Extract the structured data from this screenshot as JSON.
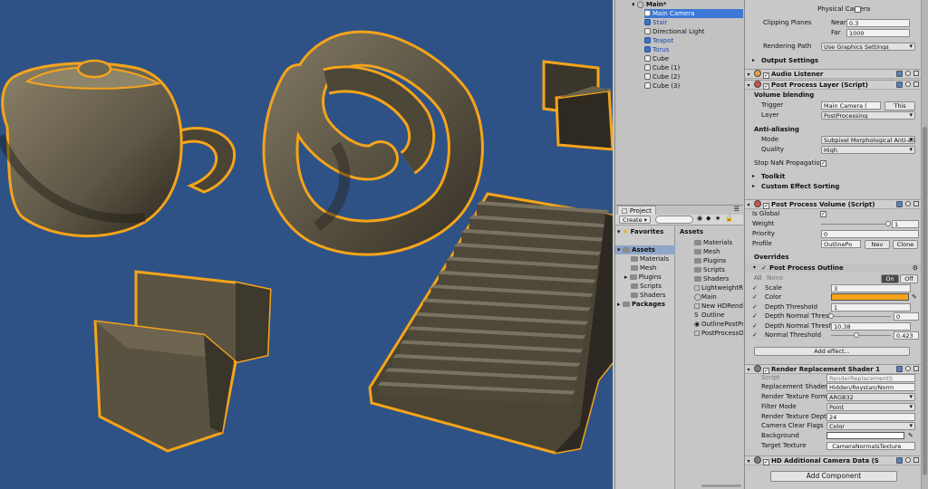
{
  "hierarchy": {
    "scene_name": "Main*",
    "items": [
      {
        "label": "Main Camera",
        "selected": true
      },
      {
        "label": "Stair",
        "prefab": true
      },
      {
        "label": "Directional Light"
      },
      {
        "label": "Teapot",
        "prefab": true
      },
      {
        "label": "Torus",
        "prefab": true
      },
      {
        "label": "Cube"
      },
      {
        "label": "Cube (1)"
      },
      {
        "label": "Cube (2)"
      },
      {
        "label": "Cube (3)"
      }
    ]
  },
  "project": {
    "tab_label": "Project",
    "create_label": "Create",
    "favorites_label": "Favorites",
    "assets_label": "Assets",
    "packages_label": "Packages",
    "tree": [
      "Materials",
      "Mesh",
      "Plugins",
      "Scripts",
      "Shaders"
    ],
    "assets_header": "Assets",
    "asset_items": [
      "Materials",
      "Mesh",
      "Plugins",
      "Scripts",
      "Shaders",
      "LightweightRend",
      "Main",
      "New HDRender",
      "Outline",
      "OutlinePostProf",
      "PostProcessOut"
    ]
  },
  "inspector": {
    "camera_tail": {
      "physical_camera_label": "Physical Camera",
      "clipping_planes_label": "Clipping Planes",
      "near_label": "Near",
      "near_value": "0.3",
      "far_label": "Far",
      "far_value": "1000",
      "rendering_path_label": "Rendering Path",
      "rendering_path_value": "Use Graphics Settings",
      "output_settings_label": "Output Settings"
    },
    "audio_listener_label": "Audio Listener",
    "post_process_layer": {
      "title": "Post Process Layer (Script)",
      "volume_blending_label": "Volume blending",
      "trigger_label": "Trigger",
      "trigger_value": "Main Camera (",
      "this_label": "This",
      "layer_label": "Layer",
      "layer_value": "PostProcessing",
      "anti_aliasing_label": "Anti-aliasing",
      "mode_label": "Mode",
      "mode_value": "Subpixel Morphological Anti-alia",
      "quality_label": "Quality",
      "quality_value": "High",
      "stop_nan_label": "Stop NaN Propagatio",
      "toolkit_label": "Toolkit",
      "custom_sorting_label": "Custom Effect Sorting"
    },
    "post_process_volume": {
      "title": "Post Process Volume (Script)",
      "is_global_label": "Is Global",
      "weight_label": "Weight",
      "weight_value": "1",
      "priority_label": "Priority",
      "priority_value": "0",
      "profile_label": "Profile",
      "profile_value": "OutlinePo",
      "new_label": "Nev",
      "clone_label": "Clone",
      "overrides_label": "Overrides",
      "effect_title": "Post Process Outline",
      "all_label": "All",
      "none_label": "None",
      "on_label": "On",
      "off_label": "Off",
      "scale_label": "Scale",
      "scale_value": "3",
      "color_label": "Color",
      "color_hex": "#f5a41a",
      "depth_threshold_label": "Depth Threshold",
      "depth_threshold_value": "1",
      "depth_normal_threshold_label": "Depth Normal Thresh",
      "depth_normal_threshold_value": "0",
      "depth_normal_threshold_scale_label": "Depth Normal Thresh",
      "depth_normal_threshold_scale_value": "10.38",
      "normal_threshold_label": "Normal Threshold",
      "normal_threshold_value": "0.423",
      "add_effect_label": "Add effect..."
    },
    "render_replacement": {
      "title": "Render Replacement Shader 1",
      "script_label": "Script",
      "script_value": "RenderReplacementS",
      "replacement_shader_label": "Replacement Shader",
      "replacement_shader_value": "Hidden/Roystan/Norm",
      "texture_format_label": "Render Texture Form",
      "texture_format_value": "ARGB32",
      "filter_mode_label": "Filter Mode",
      "filter_mode_value": "Point",
      "texture_depth_label": "Render Texture Dept",
      "texture_depth_value": "24",
      "clear_flags_label": "Camera Clear Flags",
      "clear_flags_value": "Color",
      "background_label": "Background",
      "target_texture_label": "Target Texture",
      "target_texture_value": "_CameraNormalsTexture"
    },
    "hd_camera_label": "HD Additional Camera Data (S",
    "add_component_label": "Add Component"
  },
  "colors": {
    "scene_background": "#2e5286",
    "outline": "#f5a41a",
    "object": "#6b6350",
    "selection": "#3d78d6"
  }
}
